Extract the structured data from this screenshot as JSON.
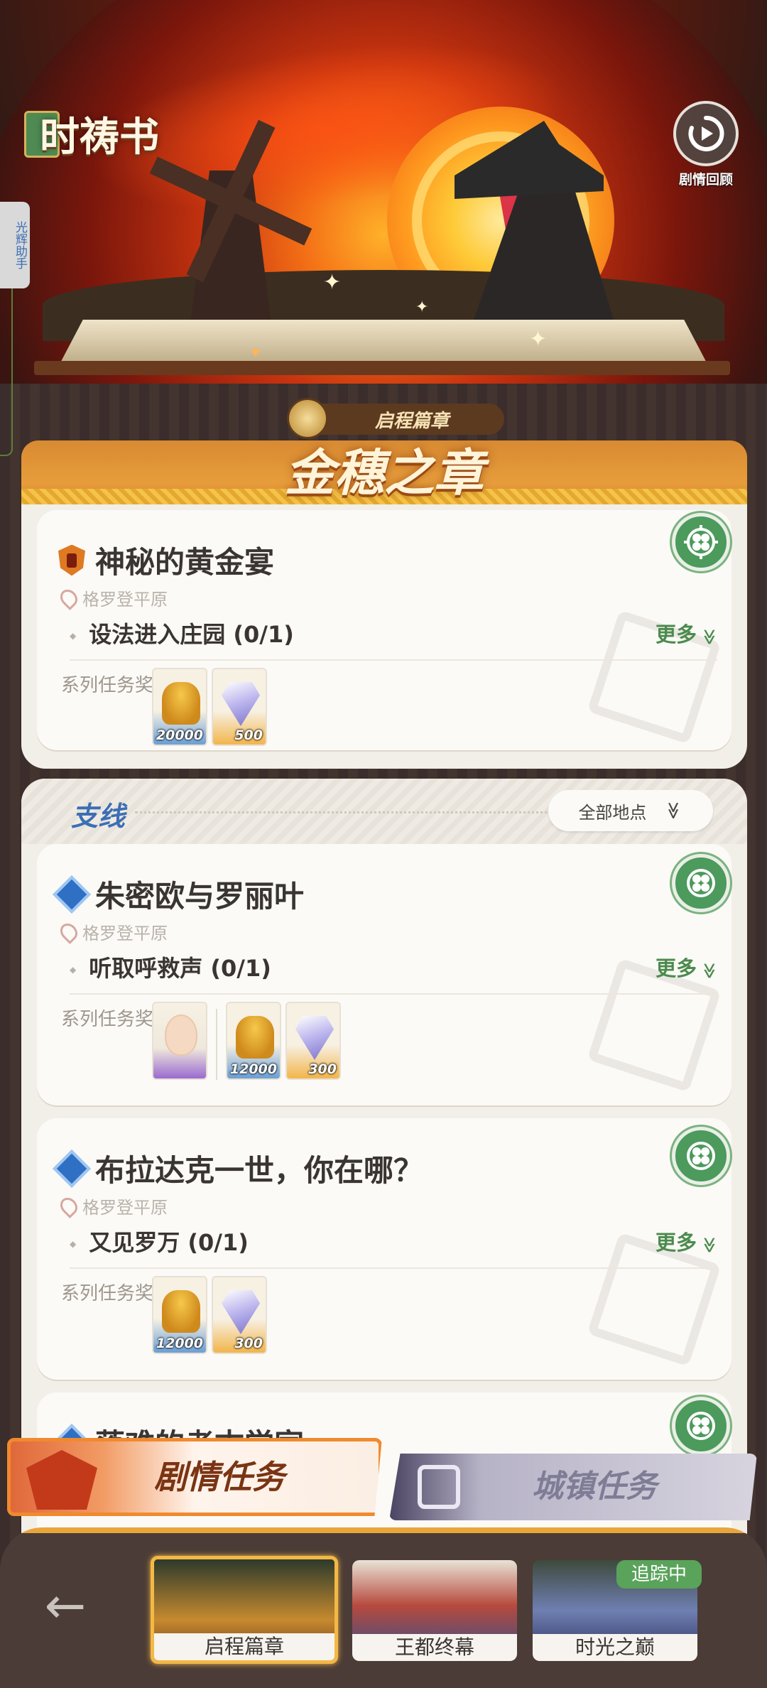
{
  "header": {
    "logo_text": "时祷书",
    "replay_label": "剧情回顾",
    "side_tab_label": "光辉助手"
  },
  "chapter": {
    "tag": "启程篇章",
    "title": "金穗之章"
  },
  "main_quest": {
    "title": "神秘的黄金宴",
    "location": "格罗登平原",
    "task": "设法进入庄园 (0/1)",
    "more_label": "更多",
    "reward_label": "系列任务奖励",
    "rewards": [
      {
        "type": "coin",
        "qty": "20000"
      },
      {
        "type": "gem",
        "qty": "500"
      }
    ]
  },
  "side_quests": {
    "section_title": "支线",
    "filter_label": "全部地点",
    "items": [
      {
        "title": "朱密欧与罗丽叶",
        "location": "格罗登平原",
        "task": "听取呼救声 (0/1)",
        "more_label": "更多",
        "reward_label": "系列任务奖励",
        "rewards": [
          {
            "type": "avatar",
            "qty": ""
          },
          {
            "type": "coin",
            "qty": "12000"
          },
          {
            "type": "gem",
            "qty": "300"
          }
        ]
      },
      {
        "title": "布拉达克一世，你在哪？",
        "location": "格罗登平原",
        "task": "又见罗万 (0/1)",
        "more_label": "更多",
        "reward_label": "系列任务奖励",
        "rewards": [
          {
            "type": "coin",
            "qty": "12000"
          },
          {
            "type": "gem",
            "qty": "300"
          }
        ]
      },
      {
        "title": "落难的考古学家",
        "location": "",
        "task": "",
        "more_label": "",
        "reward_label": "",
        "rewards": []
      }
    ]
  },
  "tabs": {
    "story": "剧情任务",
    "town": "城镇任务"
  },
  "chapters_nav": {
    "items": [
      {
        "label": "启程篇章",
        "active": true
      },
      {
        "label": "王都终幕",
        "active": false
      },
      {
        "label": "时光之巅",
        "active": false
      }
    ],
    "tracking_badge": "追踪中"
  },
  "colors": {
    "accent_green": "#4c9a5c",
    "accent_orange": "#f08a2e",
    "side_title_blue": "#3c6fb4"
  }
}
